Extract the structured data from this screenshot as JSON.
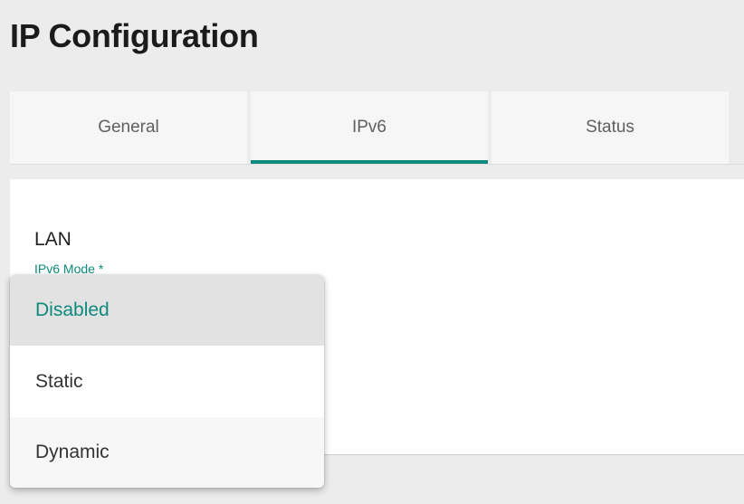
{
  "page": {
    "title": "IP Configuration"
  },
  "tabs": [
    {
      "label": "General",
      "active": false
    },
    {
      "label": "IPv6",
      "active": true
    },
    {
      "label": "Status",
      "active": false
    }
  ],
  "section": {
    "title": "LAN",
    "field_label": "IPv6 Mode *"
  },
  "dropdown": {
    "selected": "Disabled",
    "options": [
      {
        "label": "Disabled"
      },
      {
        "label": "Static"
      },
      {
        "label": "Dynamic"
      }
    ]
  },
  "colors": {
    "accent": "#0d8a7c",
    "page_background": "#ececec",
    "tab_background": "#f6f6f6",
    "selected_option_background": "#e2e2e2"
  }
}
